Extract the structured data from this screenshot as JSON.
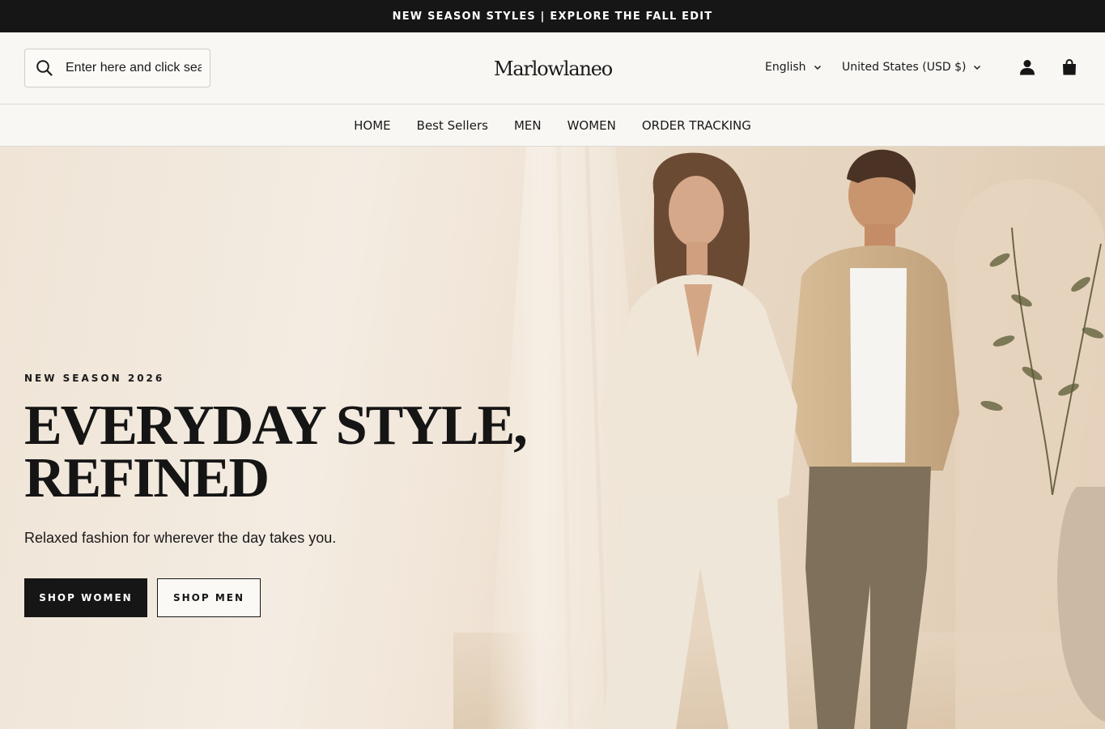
{
  "announcement": {
    "text": "NEW SEASON STYLES | EXPLORE THE FALL EDIT"
  },
  "header": {
    "search": {
      "placeholder": "Enter here and click search"
    },
    "logo": "Marlowlaneo",
    "language": "English",
    "currency": "United States (USD $)"
  },
  "nav": {
    "items": [
      {
        "label": "HOME"
      },
      {
        "label": "Best Sellers"
      },
      {
        "label": "MEN"
      },
      {
        "label": "WOMEN"
      },
      {
        "label": "ORDER TRACKING"
      }
    ]
  },
  "hero": {
    "eyebrow": "NEW SEASON 2026",
    "headline": "EVERYDAY STYLE, REFINED",
    "subline": "Relaxed fashion for wherever the day takes you.",
    "cta_women": "SHOP WOMEN",
    "cta_men": "SHOP MEN"
  },
  "icons": {
    "search": "search-icon",
    "language_chevron": "chevron-down-icon",
    "currency_chevron": "chevron-down-icon",
    "account": "user-icon",
    "cart": "shopping-bag-icon"
  }
}
